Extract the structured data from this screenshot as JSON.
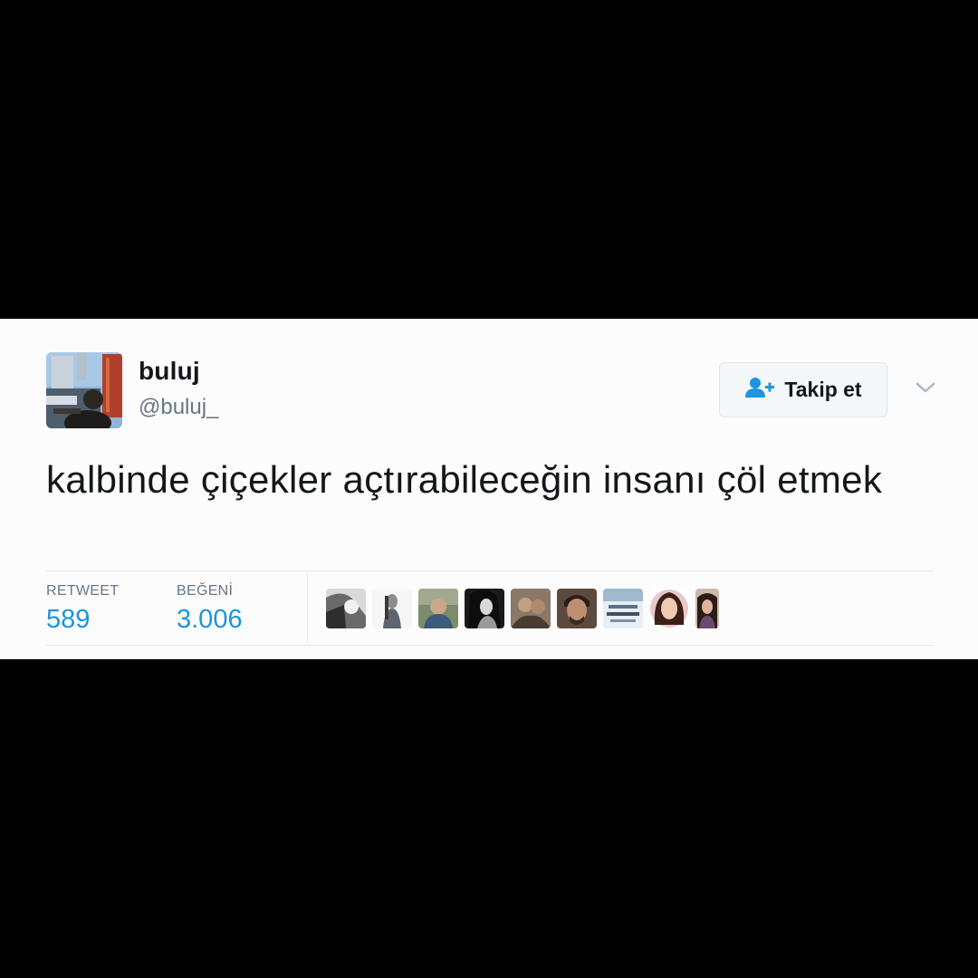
{
  "tweet": {
    "display_name": "buluj",
    "username": "@buluj_",
    "text": "kalbinde çiçekler açtırabileceğin insanı çöl etmek",
    "follow_button": {
      "label": "Takip et",
      "icon": "add-user-icon"
    },
    "menu_icon": "chevron-down-icon",
    "avatar_icon": "profile-photo"
  },
  "stats": {
    "retweet": {
      "label": "RETWEET",
      "value": "589"
    },
    "likes": {
      "label": "BEĞENİ",
      "value": "3.006"
    }
  },
  "likers": [
    {
      "name": "liker-avatar-1"
    },
    {
      "name": "liker-avatar-2"
    },
    {
      "name": "liker-avatar-3"
    },
    {
      "name": "liker-avatar-4"
    },
    {
      "name": "liker-avatar-5"
    },
    {
      "name": "liker-avatar-6"
    },
    {
      "name": "liker-avatar-7"
    },
    {
      "name": "liker-avatar-8"
    },
    {
      "name": "liker-avatar-9"
    }
  ],
  "colors": {
    "background": "#000000",
    "card": "#fcfcfd",
    "accent": "#1b95e0",
    "text": "#14171a",
    "muted": "#657786"
  }
}
